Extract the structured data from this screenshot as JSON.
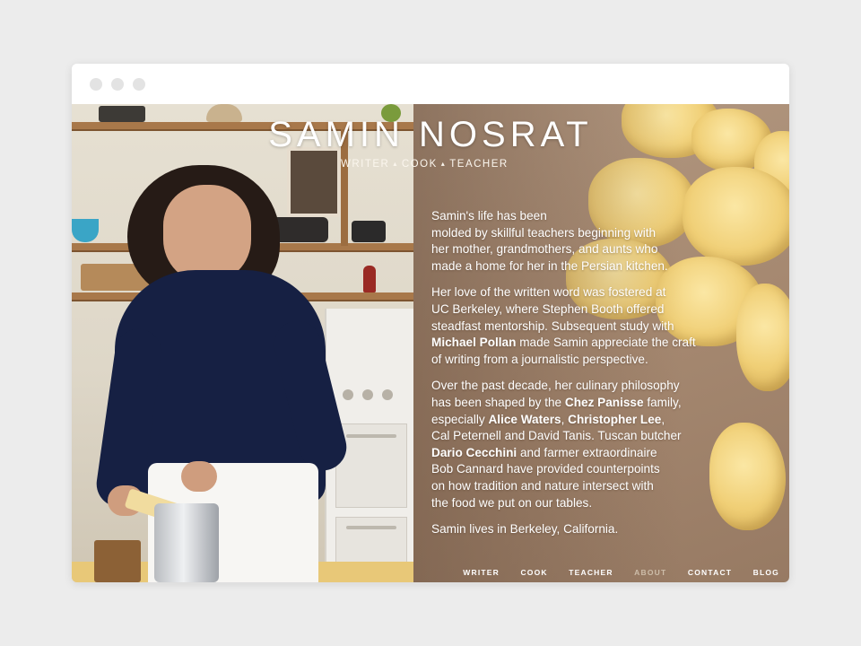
{
  "window": {
    "controls": [
      "close",
      "minimize",
      "maximize"
    ]
  },
  "header": {
    "title": "SAMIN NOSRAT",
    "tagline": [
      "WRITER",
      "COOK",
      "TEACHER"
    ],
    "tagline_separator": "▴"
  },
  "bio": {
    "p1": [
      "Samin's life has been",
      "molded by skillful teachers beginning with",
      "her mother, grandmothers, and aunts who",
      "made a home for her in the Persian kitchen."
    ],
    "p2": {
      "l1": "Her love of the written word was fostered at",
      "l2": "UC Berkeley, where Stephen Booth offered",
      "l3": "steadfast mentorship. Subsequent study with",
      "l4_bold": "Michael Pollan",
      "l4_rest": " made Samin appreciate the craft",
      "l5": "of writing from a journalistic perspective."
    },
    "p3": {
      "l1": "Over the past decade, her culinary philosophy",
      "l2_pre": "has been shaped by the ",
      "l2_bold": "Chez Panisse",
      "l2_post": " family,",
      "l3_pre": "especially ",
      "l3_bold1": "Alice Waters",
      "l3_mid": ", ",
      "l3_bold2": "Christopher Lee",
      "l3_post": ",",
      "l4": "Cal Peternell and David Tanis. Tuscan butcher",
      "l5_bold": "Dario Cecchini",
      "l5_rest": " and farmer extraordinaire",
      "l6": "Bob Cannard have provided counterpoints",
      "l7": "on how tradition and nature intersect with",
      "l8": "the food we put on our tables."
    },
    "p4": "Samin lives in Berkeley, California."
  },
  "nav": {
    "items": [
      {
        "label": "WRITER"
      },
      {
        "label": "COOK"
      },
      {
        "label": "TEACHER"
      },
      {
        "label": "ABOUT",
        "active": true
      },
      {
        "label": "CONTACT"
      },
      {
        "label": "BLOG"
      }
    ]
  },
  "colors": {
    "page_bg": "#ececec",
    "titlebar_bg": "#ffffff",
    "window_dot": "#e3e3e3",
    "text_on_photo": "#ffffff",
    "nav_active": "#cdbda9",
    "shirt": "#162043",
    "pasta": "#f0cf76"
  }
}
